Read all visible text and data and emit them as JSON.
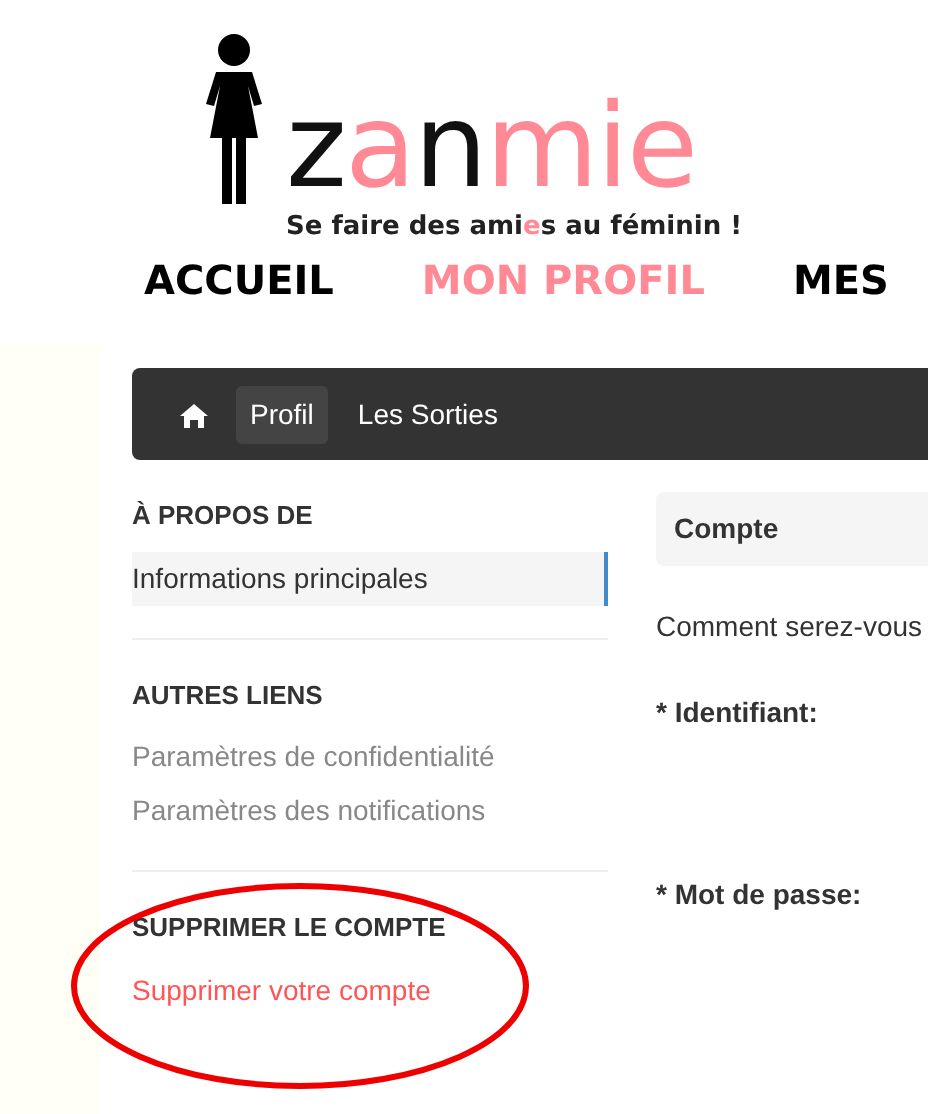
{
  "logo": {
    "word": [
      {
        "text": "z",
        "color": "#111111"
      },
      {
        "text": "a",
        "color": "#ff8a95"
      },
      {
        "text": "n",
        "color": "#111111"
      },
      {
        "text": "mie",
        "color": "#ff8a95"
      }
    ],
    "tagline": [
      {
        "text": "Se faire des ami",
        "color": "#222222"
      },
      {
        "text": "e",
        "color": "#ff8a95"
      },
      {
        "text": "s au féminin !",
        "color": "#222222"
      }
    ]
  },
  "nav": [
    {
      "label": "ACCUEIL",
      "selected": false
    },
    {
      "label": "MON PROFIL",
      "selected": true
    },
    {
      "label": "MES",
      "selected": false
    }
  ],
  "breadcrumb": [
    {
      "kind": "home",
      "selected": false
    },
    {
      "kind": "link",
      "label": "Profil",
      "selected": true
    },
    {
      "kind": "link",
      "label": "Les Sorties",
      "selected": false
    }
  ],
  "sidebar": [
    {
      "heading": "À PROPOS DE",
      "items": [
        {
          "label": "Informations principales",
          "selected": true,
          "kind": "normal"
        }
      ]
    },
    {
      "heading": "AUTRES LIENS",
      "items": [
        {
          "label": "Paramètres de confidentialité",
          "selected": false,
          "kind": "normal"
        },
        {
          "label": "Paramètres des notifications",
          "selected": false,
          "kind": "normal"
        }
      ]
    },
    {
      "heading": "SUPPRIMER LE COMPTE",
      "items": [
        {
          "label": "Supprimer votre compte",
          "selected": false,
          "kind": "danger"
        }
      ]
    }
  ],
  "annotation": {
    "kind": "ellipse",
    "color": "#ee0000"
  },
  "account": {
    "title": "Compte",
    "intro": "Comment serez-vous",
    "fields": [
      {
        "label": "* Identifiant:"
      },
      {
        "label": "* Mot de passe:"
      }
    ]
  }
}
